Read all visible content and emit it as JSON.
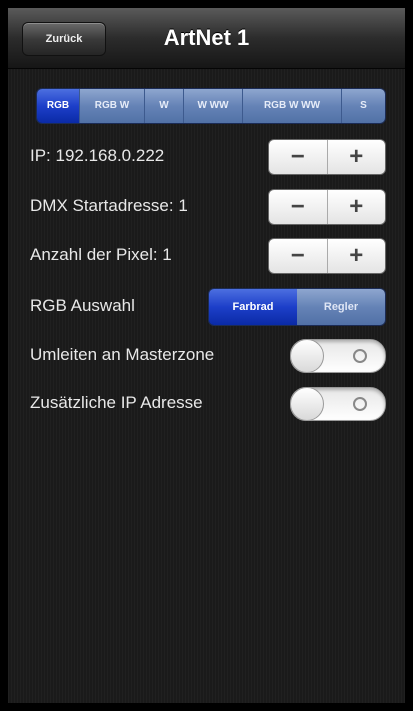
{
  "navbar": {
    "back_label": "Zurück",
    "title": "ArtNet 1"
  },
  "mode_segments": [
    {
      "label": "RGB",
      "active": true
    },
    {
      "label": "RGB W",
      "active": false
    },
    {
      "label": "W",
      "active": false
    },
    {
      "label": "W WW",
      "active": false
    },
    {
      "label": "RGB W WW",
      "active": false
    },
    {
      "label": "S",
      "active": false
    }
  ],
  "rows": {
    "ip": {
      "label": "IP: 192.168.0.222"
    },
    "dmx": {
      "label": "DMX Startadresse: 1"
    },
    "pixels": {
      "label": "Anzahl der Pixel: 1"
    },
    "stepper": {
      "minus": "−",
      "plus": "+"
    },
    "rgb_select": {
      "label": "RGB Auswahl",
      "options": [
        {
          "label": "Farbrad",
          "active": true
        },
        {
          "label": "Regler",
          "active": false
        }
      ]
    },
    "master_zone": {
      "label": "Umleiten an Masterzone",
      "state": "off"
    },
    "extra_ip": {
      "label": "Zusätzliche IP Adresse",
      "state": "off"
    }
  },
  "colors": {
    "segment_active": "#1d3fc9",
    "segment_inactive": "#6583b6",
    "background": "#1c1c1c"
  }
}
